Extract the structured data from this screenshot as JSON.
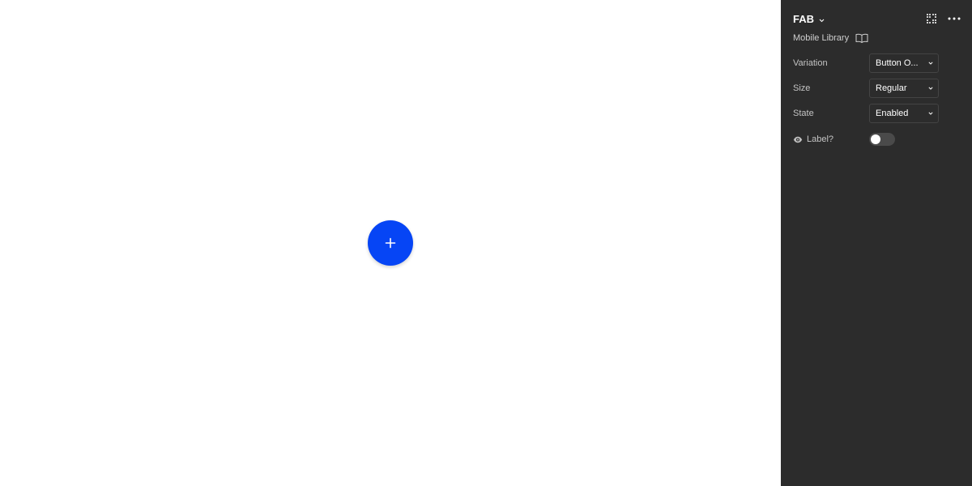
{
  "canvas": {
    "fab": {
      "icon": "plus-icon",
      "color": "#0645f5"
    }
  },
  "panel": {
    "background": "#2c2c2c",
    "component_name": "FAB",
    "library_name": "Mobile Library",
    "properties": [
      {
        "label": "Variation",
        "value": "Button O..."
      },
      {
        "label": "Size",
        "value": "Regular"
      },
      {
        "label": "State",
        "value": "Enabled"
      }
    ],
    "label_toggle": {
      "label": "Label?",
      "enabled": false
    },
    "icons": {
      "title_chevron": "chevron-down-icon",
      "grid": "grid-icon",
      "more": "more-horizontal-icon",
      "library": "book-icon",
      "visibility": "eye-icon"
    }
  }
}
